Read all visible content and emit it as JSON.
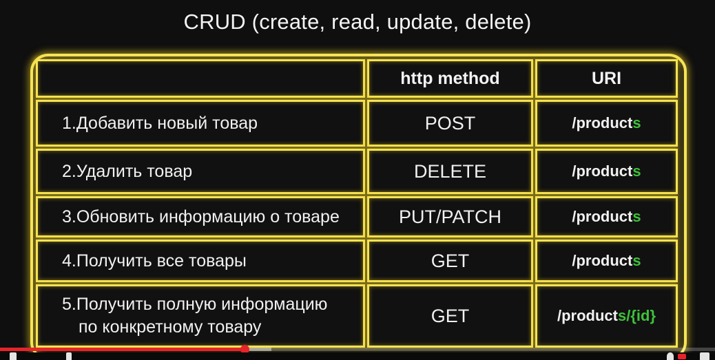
{
  "slide": {
    "title": "CRUD (create, read, update, delete)"
  },
  "table": {
    "headers": {
      "task": "",
      "method": "http method",
      "uri": "URI"
    },
    "rows": [
      {
        "task": "1.Добавить новый товар",
        "method": "POST",
        "uri_base": "/product",
        "uri_accent": "s"
      },
      {
        "task": "2.Удалить товар",
        "method": "DELETE",
        "uri_base": "/product",
        "uri_accent": "s"
      },
      {
        "task": "3.Обновить информацию о товаре",
        "method": "PUT/PATCH",
        "uri_base": "/product",
        "uri_accent": "s"
      },
      {
        "task": "4.Получить все товары",
        "method": "GET",
        "uri_base": "/product",
        "uri_accent": "s"
      },
      {
        "task_line1": "5.Получить полную информацию",
        "task_line2": "по конкретному товару",
        "method": "GET",
        "uri_base": "/product",
        "uri_accent": "s/{id}"
      }
    ]
  },
  "player": {
    "played_fraction": 0.342,
    "loaded_fraction": 0.38
  },
  "colors": {
    "frame_glow": "#f5e354",
    "uri_accent": "#3fc23a",
    "progress_played": "#e8232a"
  }
}
